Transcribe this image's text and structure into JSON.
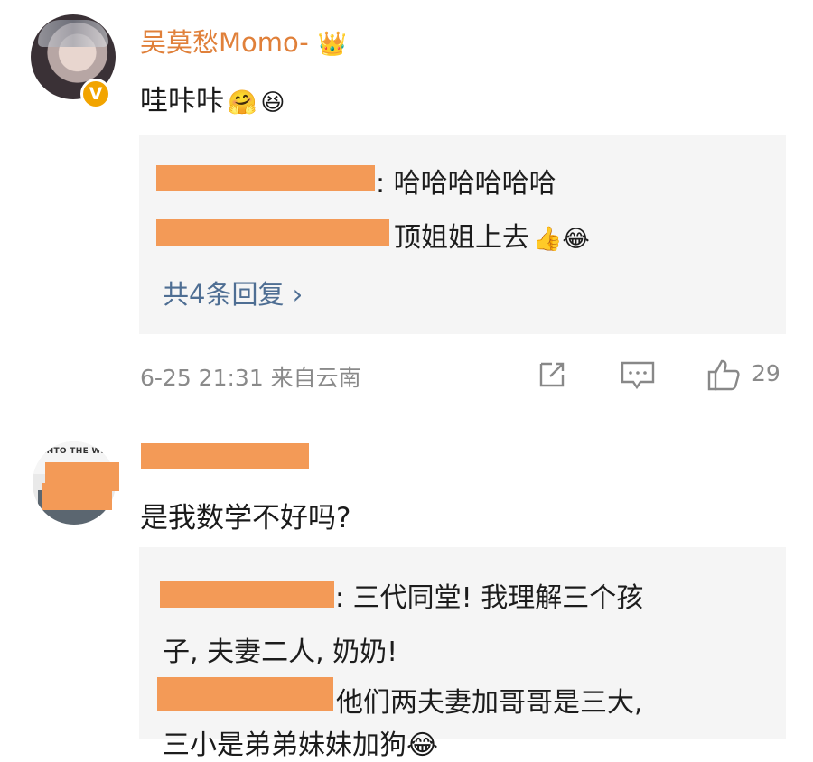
{
  "comments": [
    {
      "name": "吴莫愁Momo-",
      "text": "哇咔咔",
      "text_emojis": [
        "🤗",
        "😆"
      ],
      "replies": [
        {
          "text": ": 哈哈哈哈哈哈",
          "emoji": ""
        },
        {
          "text": "顶姐姐上去",
          "emoji": "👍😂"
        }
      ],
      "more_replies": "共4条回复 ›",
      "meta": "6-25 21:31 来自云南",
      "likes": "29"
    },
    {
      "avatar_text": "INTO THE WI",
      "text": "是我数学不好吗?",
      "replies": [
        {
          "text": ": 三代同堂! 我理解三个孩"
        },
        {
          "text": "子, 夫妻二人, 奶奶!"
        },
        {
          "text": "他们两夫妻加哥哥是三大,"
        },
        {
          "text": "三小是弟弟妹妹加狗😂"
        }
      ]
    }
  ],
  "icons": {
    "crown": "👑",
    "verified": "V",
    "share": "share-icon",
    "comment": "comment-icon",
    "like": "like-icon",
    "chevron": "›"
  },
  "colors": {
    "name": "#e0803a",
    "link": "#4e6e93",
    "redaction": "#f39a57",
    "reply_bg": "#f5f5f5"
  }
}
